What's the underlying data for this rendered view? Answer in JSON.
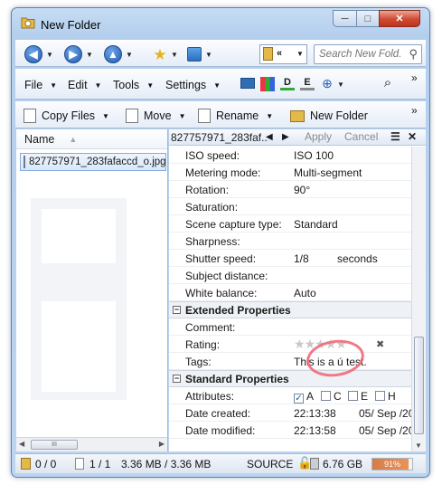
{
  "window": {
    "title": "New Folder",
    "minimize": "─",
    "maximize": "□",
    "close": "✕"
  },
  "navbar": {
    "back": "◀",
    "forward": "▶",
    "up": "▲",
    "address_chevron": "«",
    "search_placeholder": "Search New Fold..."
  },
  "menubar": {
    "items": [
      "File",
      "Edit",
      "Tools",
      "Settings"
    ],
    "overflow": "»"
  },
  "filebar": {
    "copy_files": "Copy Files",
    "move": "Move",
    "rename": "Rename",
    "new_folder": "New Folder",
    "overflow": "»"
  },
  "leftpane": {
    "column_header": "Name",
    "file_name": "827757971_283fafaccd_o.jpg",
    "scroll_thumb": "III"
  },
  "properties_header": {
    "file_name": "827757971_283faf...",
    "back": "◀",
    "forward": "▶",
    "apply": "Apply",
    "cancel": "Cancel",
    "menu": "☰",
    "close": "✕"
  },
  "properties": {
    "camera": [
      {
        "label": "ISO speed:",
        "value": "ISO  100"
      },
      {
        "label": "Metering mode:",
        "value": "Multi-segment"
      },
      {
        "label": "Rotation:",
        "value": "90°"
      },
      {
        "label": "Saturation:",
        "value": ""
      },
      {
        "label": "Scene capture type:",
        "value": "Standard"
      },
      {
        "label": "Sharpness:",
        "value": ""
      },
      {
        "label": "Shutter speed:",
        "value": "1/8",
        "unit": "seconds"
      },
      {
        "label": "Subject distance:",
        "value": ""
      },
      {
        "label": "White balance:",
        "value": "Auto"
      }
    ],
    "extended_title": "Extended Properties",
    "extended": {
      "comment_label": "Comment:",
      "rating_label": "Rating:",
      "rating_value": 0,
      "rating_max": 5,
      "rating_clear": "✖",
      "tags_label": "Tags:",
      "tags_value": "This is a ú test."
    },
    "standard_title": "Standard Properties",
    "standard": {
      "attributes_label": "Attributes:",
      "attributes": [
        {
          "letter": "A",
          "checked": true
        },
        {
          "letter": "C",
          "checked": false
        },
        {
          "letter": "E",
          "checked": false
        },
        {
          "letter": "H",
          "checked": false
        }
      ],
      "created_label": "Date created:",
      "created_time": "22:13:38",
      "created_date": "05/ Sep /20",
      "modified_label": "Date modified:",
      "modified_time": "22:13:58",
      "modified_date": "05/ Sep /20"
    }
  },
  "statusbar": {
    "selected": "0 / 0",
    "files": "1 / 1",
    "size": "3.36 MB / 3.36 MB",
    "source": "SOURCE",
    "free": "6.76 GB",
    "usage_percent": 91,
    "usage_label": "91%"
  },
  "colors": {
    "accent": "#1e5ab2",
    "usage_bar": "#e9925a",
    "circle": "#ef6a78"
  }
}
